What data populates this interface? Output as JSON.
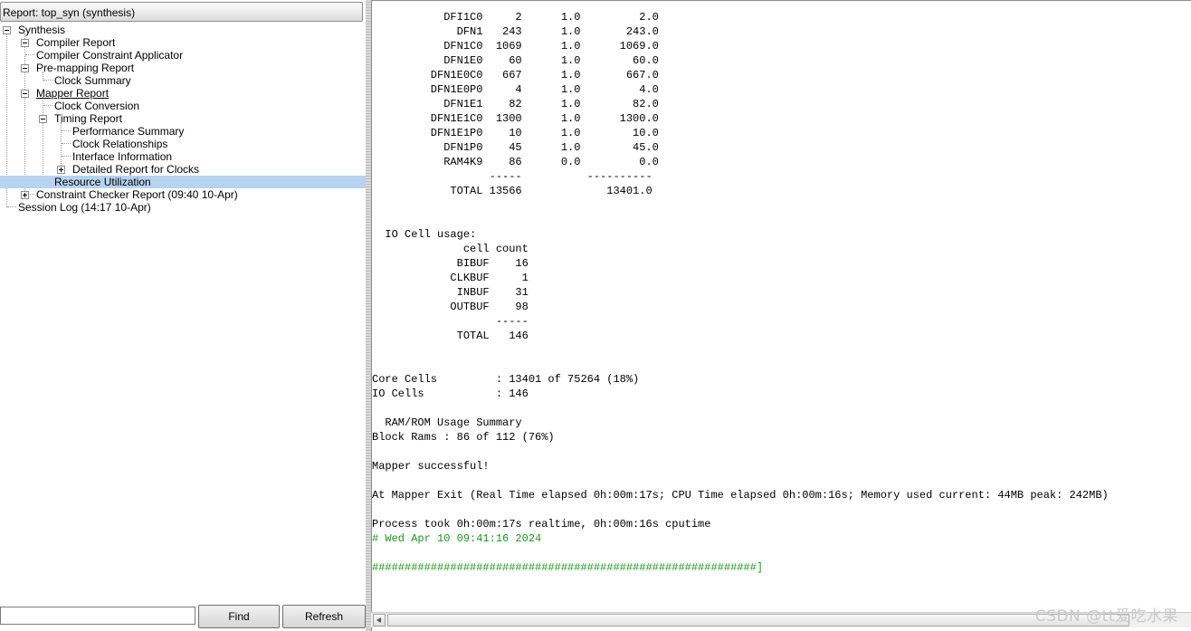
{
  "report_title": "Report: top_syn (synthesis)",
  "tree": [
    {
      "label": "Synthesis"
    },
    {
      "label": "Compiler Report"
    },
    {
      "label": "Compiler Constraint Applicator"
    },
    {
      "label": "Pre-mapping Report"
    },
    {
      "label": "Clock Summary"
    },
    {
      "label": "Mapper Report"
    },
    {
      "label": "Clock Conversion"
    },
    {
      "label": "Timing Report"
    },
    {
      "label": "Performance Summary"
    },
    {
      "label": "Clock Relationships"
    },
    {
      "label": "Interface Information"
    },
    {
      "label": "Detailed Report for Clocks"
    },
    {
      "label": "Resource Utilization"
    },
    {
      "label": "Constraint Checker Report (09:40 10-Apr)"
    },
    {
      "label": "Session Log (14:17 10-Apr)"
    }
  ],
  "find_input": {
    "value": ""
  },
  "buttons": {
    "find": "Find",
    "refresh": "Refresh"
  },
  "log_lines": [
    "           DFI1C0     2      1.0         2.0",
    "             DFN1   243      1.0       243.0",
    "           DFN1C0  1069      1.0      1069.0",
    "           DFN1E0    60      1.0        60.0",
    "         DFN1E0C0   667      1.0       667.0",
    "         DFN1E0P0     4      1.0         4.0",
    "           DFN1E1    82      1.0        82.0",
    "         DFN1E1C0  1300      1.0      1300.0",
    "         DFN1E1P0    10      1.0        10.0",
    "           DFN1P0    45      1.0        45.0",
    "           RAM4K9    86      0.0         0.0",
    "                  -----          ----------",
    "            TOTAL 13566             13401.0",
    "",
    "",
    "  IO Cell usage:",
    "              cell count",
    "             BIBUF    16",
    "            CLKBUF     1",
    "             INBUF    31",
    "            OUTBUF    98",
    "                   -----",
    "             TOTAL   146",
    "",
    "",
    "Core Cells         : 13401 of 75264 (18%)",
    "IO Cells           : 146",
    "",
    "  RAM/ROM Usage Summary",
    "Block Rams : 86 of 112 (76%)",
    "",
    "Mapper successful!",
    "",
    "At Mapper Exit (Real Time elapsed 0h:00m:17s; CPU Time elapsed 0h:00m:16s; Memory used current: 44MB peak: 242MB)",
    "",
    "Process took 0h:00m:17s realtime, 0h:00m:16s cputime",
    "# Wed Apr 10 09:41:16 2024",
    "",
    "###########################################################]"
  ],
  "watermark": "CSDN @tt爱吃水果"
}
